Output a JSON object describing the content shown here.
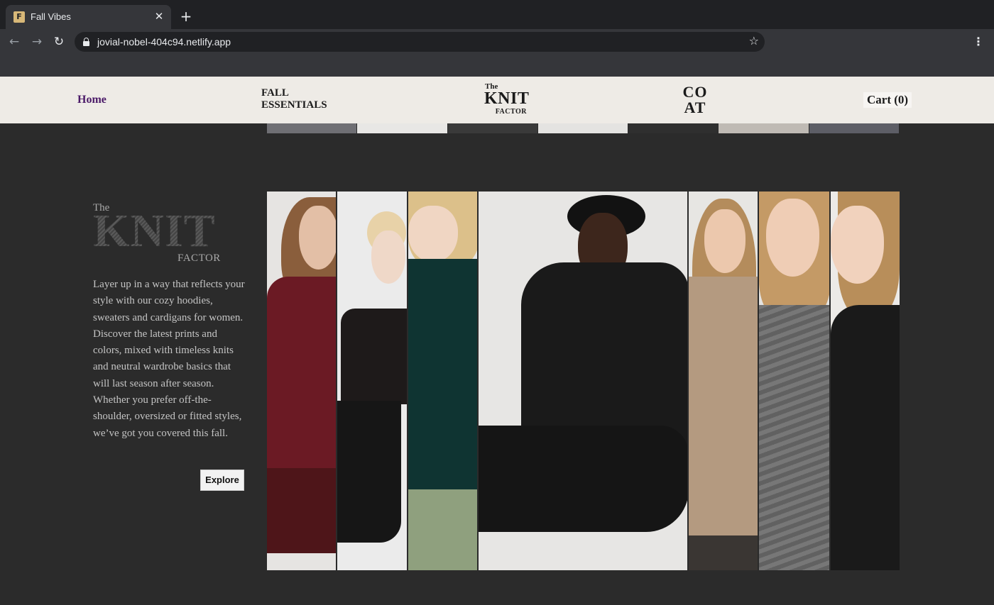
{
  "browser": {
    "tab_title": "Fall Vibes",
    "favicon_letter": "F",
    "url": "jovial-nobel-404c94.netlify.app",
    "icons": {
      "back": "arrow-left-icon",
      "forward": "arrow-right-icon",
      "reload": "reload-icon",
      "lock": "lock-icon",
      "bookmark": "star-icon",
      "menu": "kebab-menu-icon",
      "close_tab": "close-icon",
      "new_tab": "plus-icon"
    }
  },
  "header": {
    "home": "Home",
    "fall_line1": "FALL",
    "fall_line2": "ESSENTIALS",
    "logo_the": "The",
    "logo_knit": "KNIT",
    "logo_factor": "FACTOR",
    "coat_line1": "CO",
    "coat_line2": "AT",
    "cart": "Cart (0)"
  },
  "hero": {
    "the": "The",
    "knit": "KNIT",
    "factor": "FACTOR",
    "description": "Layer up in a way that reflects your style with our cozy hoodies, sweaters and cardigans for women. Discover the latest prints and colors, mixed with timeless knits and neutral wardrobe basics that will last season after season. Whether you prefer off-the-shoulder, oversized or fitted styles, we’ve got you covered this fall.",
    "explore": "Explore"
  },
  "colors": {
    "page_bg": "#2b2b2b",
    "header_bg": "#eeebe6",
    "home_link": "#4b1a68",
    "sweater_burgundy": "#6b1a24",
    "sweater_green": "#0f3432",
    "sweater_beige": "#b49a80",
    "sweater_grey": "#6e6e6e",
    "sweater_black": "#1a1a1a"
  }
}
